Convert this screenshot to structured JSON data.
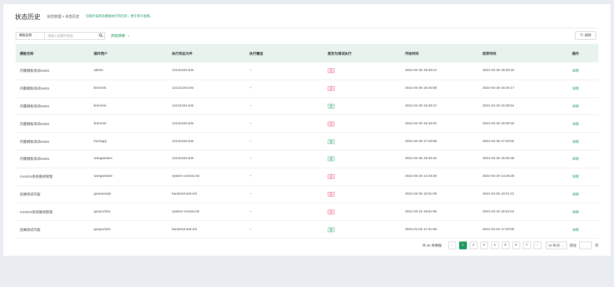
{
  "header": {
    "title": "状态历史",
    "breadcrumb": "状态管理 > 状态历史",
    "hint": "仅展示该状态模板执行的历史，便于审计查看。"
  },
  "toolbar": {
    "field_select": "模板名称",
    "search_placeholder": "请输入关键字搜索",
    "advanced_search": "高级搜索",
    "refresh": "刷新"
  },
  "table": {
    "headers": [
      "模板名称",
      "操作用户",
      "执行状态文件",
      "执行圈选",
      "是否为测试执行",
      "开始时间",
      "结束时间",
      "操作"
    ],
    "rows": [
      {
        "name": "内置模板测试test01",
        "user": "admin",
        "file": "12131234.test",
        "circle": "--",
        "is_test": "否",
        "start": "2021-04-30 18:28:12",
        "end": "2021-04-30 18:28:16",
        "action": "详情"
      },
      {
        "name": "内置模板测试test01",
        "user": "liminmin",
        "file": "12131234.test",
        "circle": "--",
        "is_test": "否",
        "start": "2021-04-30 16:40:08",
        "end": "2021-04-30 16:40:17",
        "action": "详情"
      },
      {
        "name": "内置模板测试test01",
        "user": "liminmin",
        "file": "12131234.test",
        "circle": "--",
        "is_test": "是",
        "start": "2021-04-30 16:38:47",
        "end": "2021-04-30 16:38:54",
        "action": "详情"
      },
      {
        "name": "内置模板测试test01",
        "user": "liminmin",
        "file": "12131234.test",
        "circle": "--",
        "is_test": "否",
        "start": "2021-04-30 16:38:32",
        "end": "2021-04-30 16:38:32",
        "action": "详情"
      },
      {
        "name": "内置模板测试test01",
        "user": "huxingqi",
        "file": "12131234.test",
        "circle": "--",
        "is_test": "是",
        "start": "2021-04-26 17:19:58",
        "end": "2021-04-26 17:20:02",
        "action": "详情"
      },
      {
        "name": "内置模板测试test01",
        "user": "wangweiwei",
        "file": "12131234.test",
        "circle": "--",
        "is_test": "是",
        "start": "2021-04-26 15:25:42",
        "end": "2021-04-26 15:25:46",
        "action": "详情"
      },
      {
        "name": "CentOS系统基线管理",
        "user": "wangweiwei",
        "file": "system-centos.init",
        "circle": "--",
        "is_test": "否",
        "start": "2021-04-20 14:28:26",
        "end": "2021-04-20 14:28:30",
        "action": "详情"
      },
      {
        "name": "后端测试内容",
        "user": "guanwenjie",
        "file": "backend-test.init",
        "circle": "--",
        "is_test": "否",
        "start": "2021-04-06 10:01:09",
        "end": "2021-04-06 10:01:21",
        "action": "详情"
      },
      {
        "name": "CentOS系统基线管理",
        "user": "guoyuchen",
        "file": "system-centos.init",
        "circle": "--",
        "is_test": "否",
        "start": "2021-03-10 18:51:59",
        "end": "2021-03-10 18:52:04",
        "action": "详情"
      },
      {
        "name": "后端测试内容",
        "user": "guoyuchen",
        "file": "backend-test.init",
        "circle": "--",
        "is_test": "是",
        "start": "2021-01-04 17:31:55",
        "end": "2021-01-04 17:32:05",
        "action": "详情"
      }
    ]
  },
  "pagination": {
    "total": "共 65 条数据",
    "prev": "<",
    "pages": [
      "1",
      "2",
      "3",
      "4",
      "5",
      "6",
      "7"
    ],
    "current": "1",
    "next": ">",
    "page_size": "10 条/页",
    "goto_label": "前往",
    "goto_suffix": "页"
  },
  "colors": {
    "accent": "#1a9a5c",
    "header_bg": "#e8f3ee",
    "tag_no": "#e64a6a"
  }
}
